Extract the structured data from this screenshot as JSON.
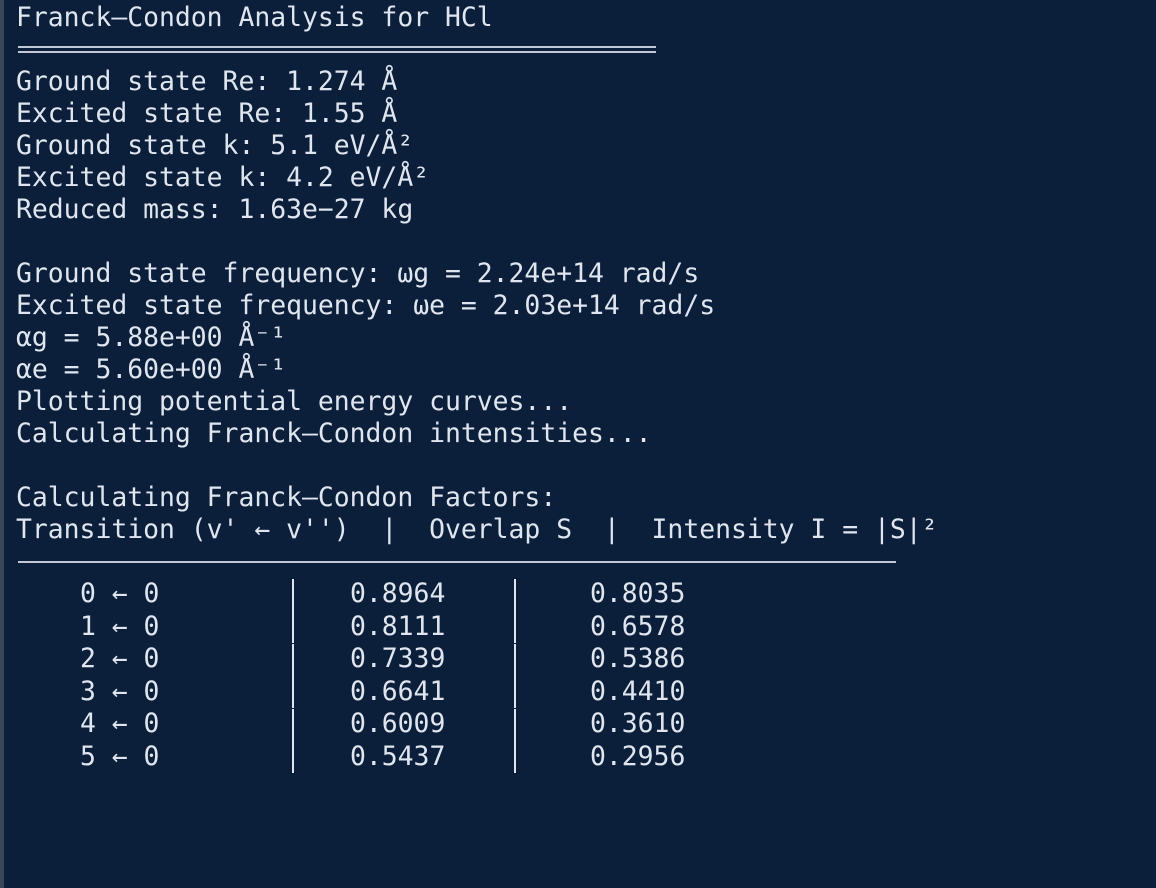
{
  "terminal": {
    "title": "Franck–Condon Analysis for HCl",
    "params": [
      "Ground state Re: 1.274 Å",
      "Excited state Re: 1.55 Å",
      "Ground state k: 5.1 eV/Å²",
      "Excited state k: 4.2 eV/Å²",
      "Reduced mass: 1.63e−27 kg"
    ],
    "derived": [
      "Ground state frequency: ωg = 2.24e+14 rad/s",
      "Excited state frequency: ωe = 2.03e+14 rad/s",
      "αg = 5.88e+00 Å⁻¹",
      "αe = 5.60e+00 Å⁻¹",
      "Plotting potential energy curves...",
      "Calculating Franck–Condon intensities..."
    ],
    "factors_heading": "Calculating Franck–Condon Factors:",
    "table_header": "Transition (v' ← v'')  |  Overlap S  |  Intensity I = |S|²",
    "rows": [
      {
        "transition": "0 ← 0",
        "overlap": "0.8964",
        "intensity": "0.8035"
      },
      {
        "transition": "1 ← 0",
        "overlap": "0.8111",
        "intensity": "0.6578"
      },
      {
        "transition": "2 ← 0",
        "overlap": "0.7339",
        "intensity": "0.5386"
      },
      {
        "transition": "3 ← 0",
        "overlap": "0.6641",
        "intensity": "0.4410"
      },
      {
        "transition": "4 ← 0",
        "overlap": "0.6009",
        "intensity": "0.3610"
      },
      {
        "transition": "5 ← 0",
        "overlap": "0.5437",
        "intensity": "0.2956"
      }
    ]
  }
}
